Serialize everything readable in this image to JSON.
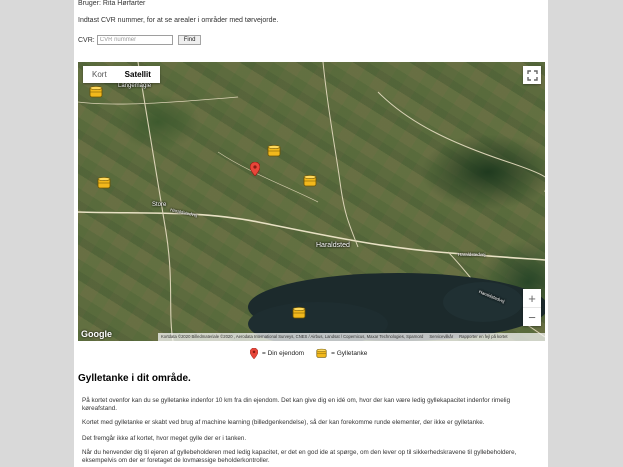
{
  "user": {
    "line": "Bruger: Rita Hørfarter"
  },
  "intro": "Indtast CVR nummer, for at se arealer i områder med tørvejorde.",
  "search": {
    "label": "CVR:",
    "placeholder": "CVR nummer",
    "value": "",
    "button": "Find"
  },
  "map": {
    "type_options": [
      "Kort",
      "Satellit"
    ],
    "active_type": "Satellit",
    "place_labels": [
      "Langemagle",
      "Store",
      "Haraldsted",
      "Haraldstedvej",
      "Haraldstedvej",
      "Haraldstedvej"
    ],
    "google_logo": "Google",
    "attribution": [
      "Kortdata ©2020 Billedmateriale ©2020 , Aerodata International Surveys, CNES / Airbus, Landsat / Copernicus, Maxar Technologies, Sparnord",
      "Servicevilkår",
      "Rapporter en fejl på kortet"
    ],
    "zoom_in": "+",
    "zoom_out": "−"
  },
  "legend": {
    "own_property": "= Din ejendom",
    "slurry_tank": "= Gylletanke",
    "colors": {
      "pin": "#e8463a",
      "tank": "#f2b81c"
    }
  },
  "section": {
    "title": "Gylletanke i dit område.",
    "paragraphs": [
      "På kortet ovenfor kan du se gylletanke indenfor 10 km fra din ejendom. Det kan give dig en idé om, hvor der kan være ledig gyllekapacitet indenfor rimelig køreafstand.",
      "Kortet med gylletanke er skabt ved brug af machine learning (billedgenkendelse), så der kan forekomme runde elementer, der ikke er gylletanke.",
      "Det fremgår ikke af kortet, hvor meget gylle der er i tanken.",
      "Når du henvender dig til ejeren af gyllebeholderen med ledig kapacitet, er det en god ide at spørge, om den lever op til sikkerhedskravene til gyllebeholdere, eksempelvis om der er foretaget de lovmæssige beholderkontroller."
    ]
  }
}
